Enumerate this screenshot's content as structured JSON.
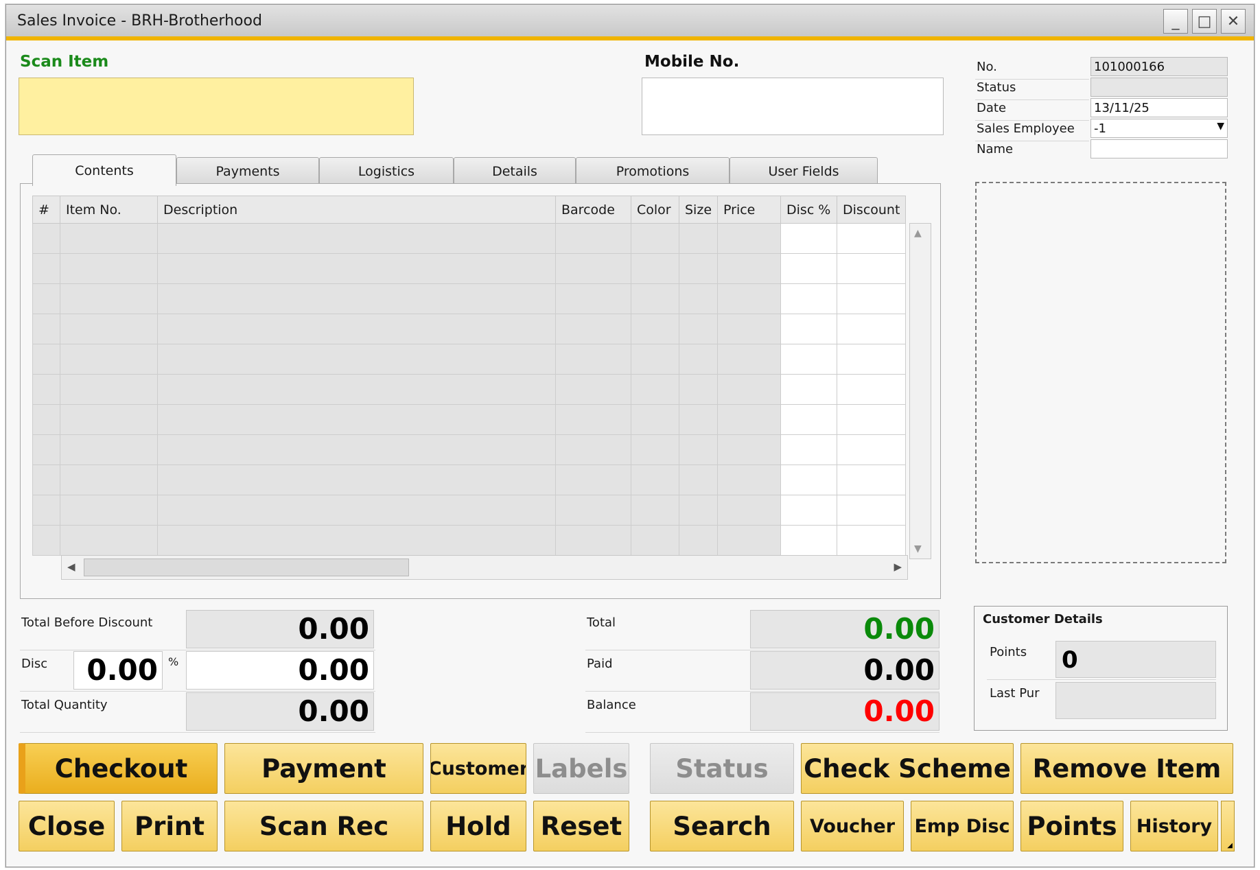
{
  "window": {
    "title": "Sales Invoice - BRH-Brotherhood",
    "minimize": "_",
    "maximize": "□",
    "close": "✕"
  },
  "scan_item": {
    "label": "Scan Item",
    "value": ""
  },
  "mobile": {
    "label": "Mobile No.",
    "value": ""
  },
  "header_fields": {
    "no_label": "No.",
    "no_value": "101000166",
    "status_label": "Status",
    "status_value": "",
    "date_label": "Date",
    "date_value": "13/11/25",
    "sales_employee_label": "Sales Employee",
    "sales_employee_value": "-1",
    "name_label": "Name",
    "name_value": ""
  },
  "tabs": [
    "Contents",
    "Payments",
    "Logistics",
    "Details",
    "Promotions",
    "User Fields"
  ],
  "grid": {
    "columns": [
      "#",
      "Item No.",
      "Description",
      "Barcode",
      "Color",
      "Size",
      "Price",
      "Disc %",
      "Discount"
    ],
    "rows": []
  },
  "totals_left": {
    "total_before_discount_label": "Total Before Discount",
    "total_before_discount_value": "0.00",
    "disc_label": "Disc",
    "disc_percent_value": "0.00",
    "percent_sign": "%",
    "disc_amount_value": "0.00",
    "total_quantity_label": "Total Quantity",
    "total_quantity_value": "0.00"
  },
  "totals_right": {
    "total_label": "Total",
    "total_value": "0.00",
    "paid_label": "Paid",
    "paid_value": "0.00",
    "balance_label": "Balance",
    "balance_value": "0.00"
  },
  "customer_details": {
    "title": "Customer Details",
    "points_label": "Points",
    "points_value": "0",
    "last_pur_label": "Last Pur",
    "last_pur_value": ""
  },
  "buttons": {
    "checkout": "Checkout",
    "payment": "Payment",
    "customer": "Customer",
    "labels": "Labels",
    "status": "Status",
    "check_scheme": "Check Scheme",
    "remove_item": "Remove Item",
    "close": "Close",
    "print": "Print",
    "scan_rec": "Scan Rec",
    "hold": "Hold",
    "reset": "Reset",
    "search": "Search",
    "voucher": "Voucher",
    "emp_disc": "Emp Disc",
    "points": "Points",
    "history": "History"
  },
  "colors": {
    "accent": "#f0b400",
    "scan_field_bg": "#fff0a0",
    "scan_label": "#1b8a1b",
    "total_green": "#0a8a0a",
    "balance_red": "#ff0000",
    "button_bg": "#f7d870"
  }
}
